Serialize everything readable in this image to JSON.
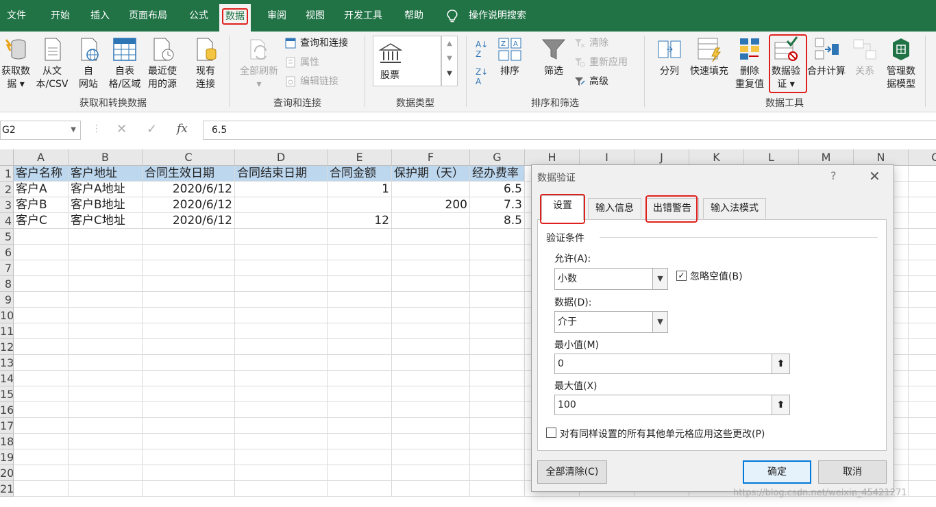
{
  "menu": {
    "items": [
      "文件",
      "开始",
      "插入",
      "页面布局",
      "公式",
      "数据",
      "审阅",
      "视图",
      "开发工具",
      "帮助"
    ],
    "active": "数据",
    "search_label": "操作说明搜索"
  },
  "ribbon": {
    "get_data": {
      "line1": "获取数",
      "line2": "据 ▾"
    },
    "from_csv": {
      "line1": "从文",
      "line2": "本/CSV"
    },
    "from_web": {
      "line1": "自",
      "line2": "网站"
    },
    "from_table": {
      "line1": "自表",
      "line2": "格/区域"
    },
    "recent": {
      "line1": "最近使",
      "line2": "用的源"
    },
    "existing": {
      "line1": "现有",
      "line2": "连接"
    },
    "group1_label": "获取和转换数据",
    "refresh_all": {
      "line1": "全部刷新",
      "line2": "▾"
    },
    "query_conn": "查询和连接",
    "properties": "属性",
    "edit_links": "编辑链接",
    "group2_label": "查询和连接",
    "stock": "股票",
    "group3_label": "数据类型",
    "sort": "排序",
    "filter": "筛选",
    "clear": "清除",
    "reapply": "重新应用",
    "advanced": "高级",
    "group4_label": "排序和筛选",
    "split": "分列",
    "flash_fill": "快速填充",
    "remove_dup": {
      "line1": "删除",
      "line2": "重复值"
    },
    "data_validation": {
      "line1": "数据验",
      "line2": "证 ▾"
    },
    "consolidate": "合并计算",
    "relationships": "关系",
    "data_model": {
      "line1": "管理数",
      "line2": "据模型"
    },
    "group5_label": "数据工具"
  },
  "formula_bar": {
    "name_box": "G2",
    "fx": "fx",
    "cancel": "✕",
    "enter": "✓",
    "value": "6.5"
  },
  "grid": {
    "columns": [
      "A",
      "B",
      "C",
      "D",
      "E",
      "F",
      "G",
      "H",
      "I",
      "J",
      "K",
      "L",
      "M",
      "N",
      "O"
    ],
    "rows": [
      "1",
      "2",
      "3",
      "4",
      "5",
      "6",
      "7",
      "8",
      "9",
      "10",
      "11",
      "12",
      "13",
      "14",
      "15",
      "16",
      "17",
      "18",
      "19",
      "20",
      "21"
    ],
    "header_row": [
      "客户名称",
      "客户地址",
      "合同生效日期",
      "合同结束日期",
      "合同金额",
      "保护期（天）",
      "经办费率"
    ],
    "data": [
      [
        "客户A",
        "客户A地址",
        "2020/6/12",
        "",
        "1",
        "",
        "6.5"
      ],
      [
        "客户B",
        "客户B地址",
        "2020/6/12",
        "",
        "",
        "200",
        "7.3"
      ],
      [
        "客户C",
        "客户C地址",
        "2020/6/12",
        "",
        "12",
        "",
        "8.5"
      ]
    ]
  },
  "dialog": {
    "title": "数据验证",
    "help": "?",
    "close": "✕",
    "tabs": [
      "设置",
      "输入信息",
      "出错警告",
      "输入法模式"
    ],
    "section": "验证条件",
    "allow_label": "允许(A):",
    "allow_value": "小数",
    "ignore_blank": "忽略空值(B)",
    "data_label": "数据(D):",
    "data_value": "介于",
    "min_label": "最小值(M)",
    "min_value": "0",
    "max_label": "最大值(X)",
    "max_value": "100",
    "apply_all": "对有同样设置的所有其他单元格应用这些更改(P)",
    "clear_all": "全部清除(C)",
    "ok": "确定",
    "cancel": "取消"
  },
  "watermark": "https://blog.csdn.net/weixin_45421271",
  "colors": {
    "excel_green": "#217346",
    "highlight_red": "#e0201d",
    "header_fill": "#bdd7ee"
  }
}
